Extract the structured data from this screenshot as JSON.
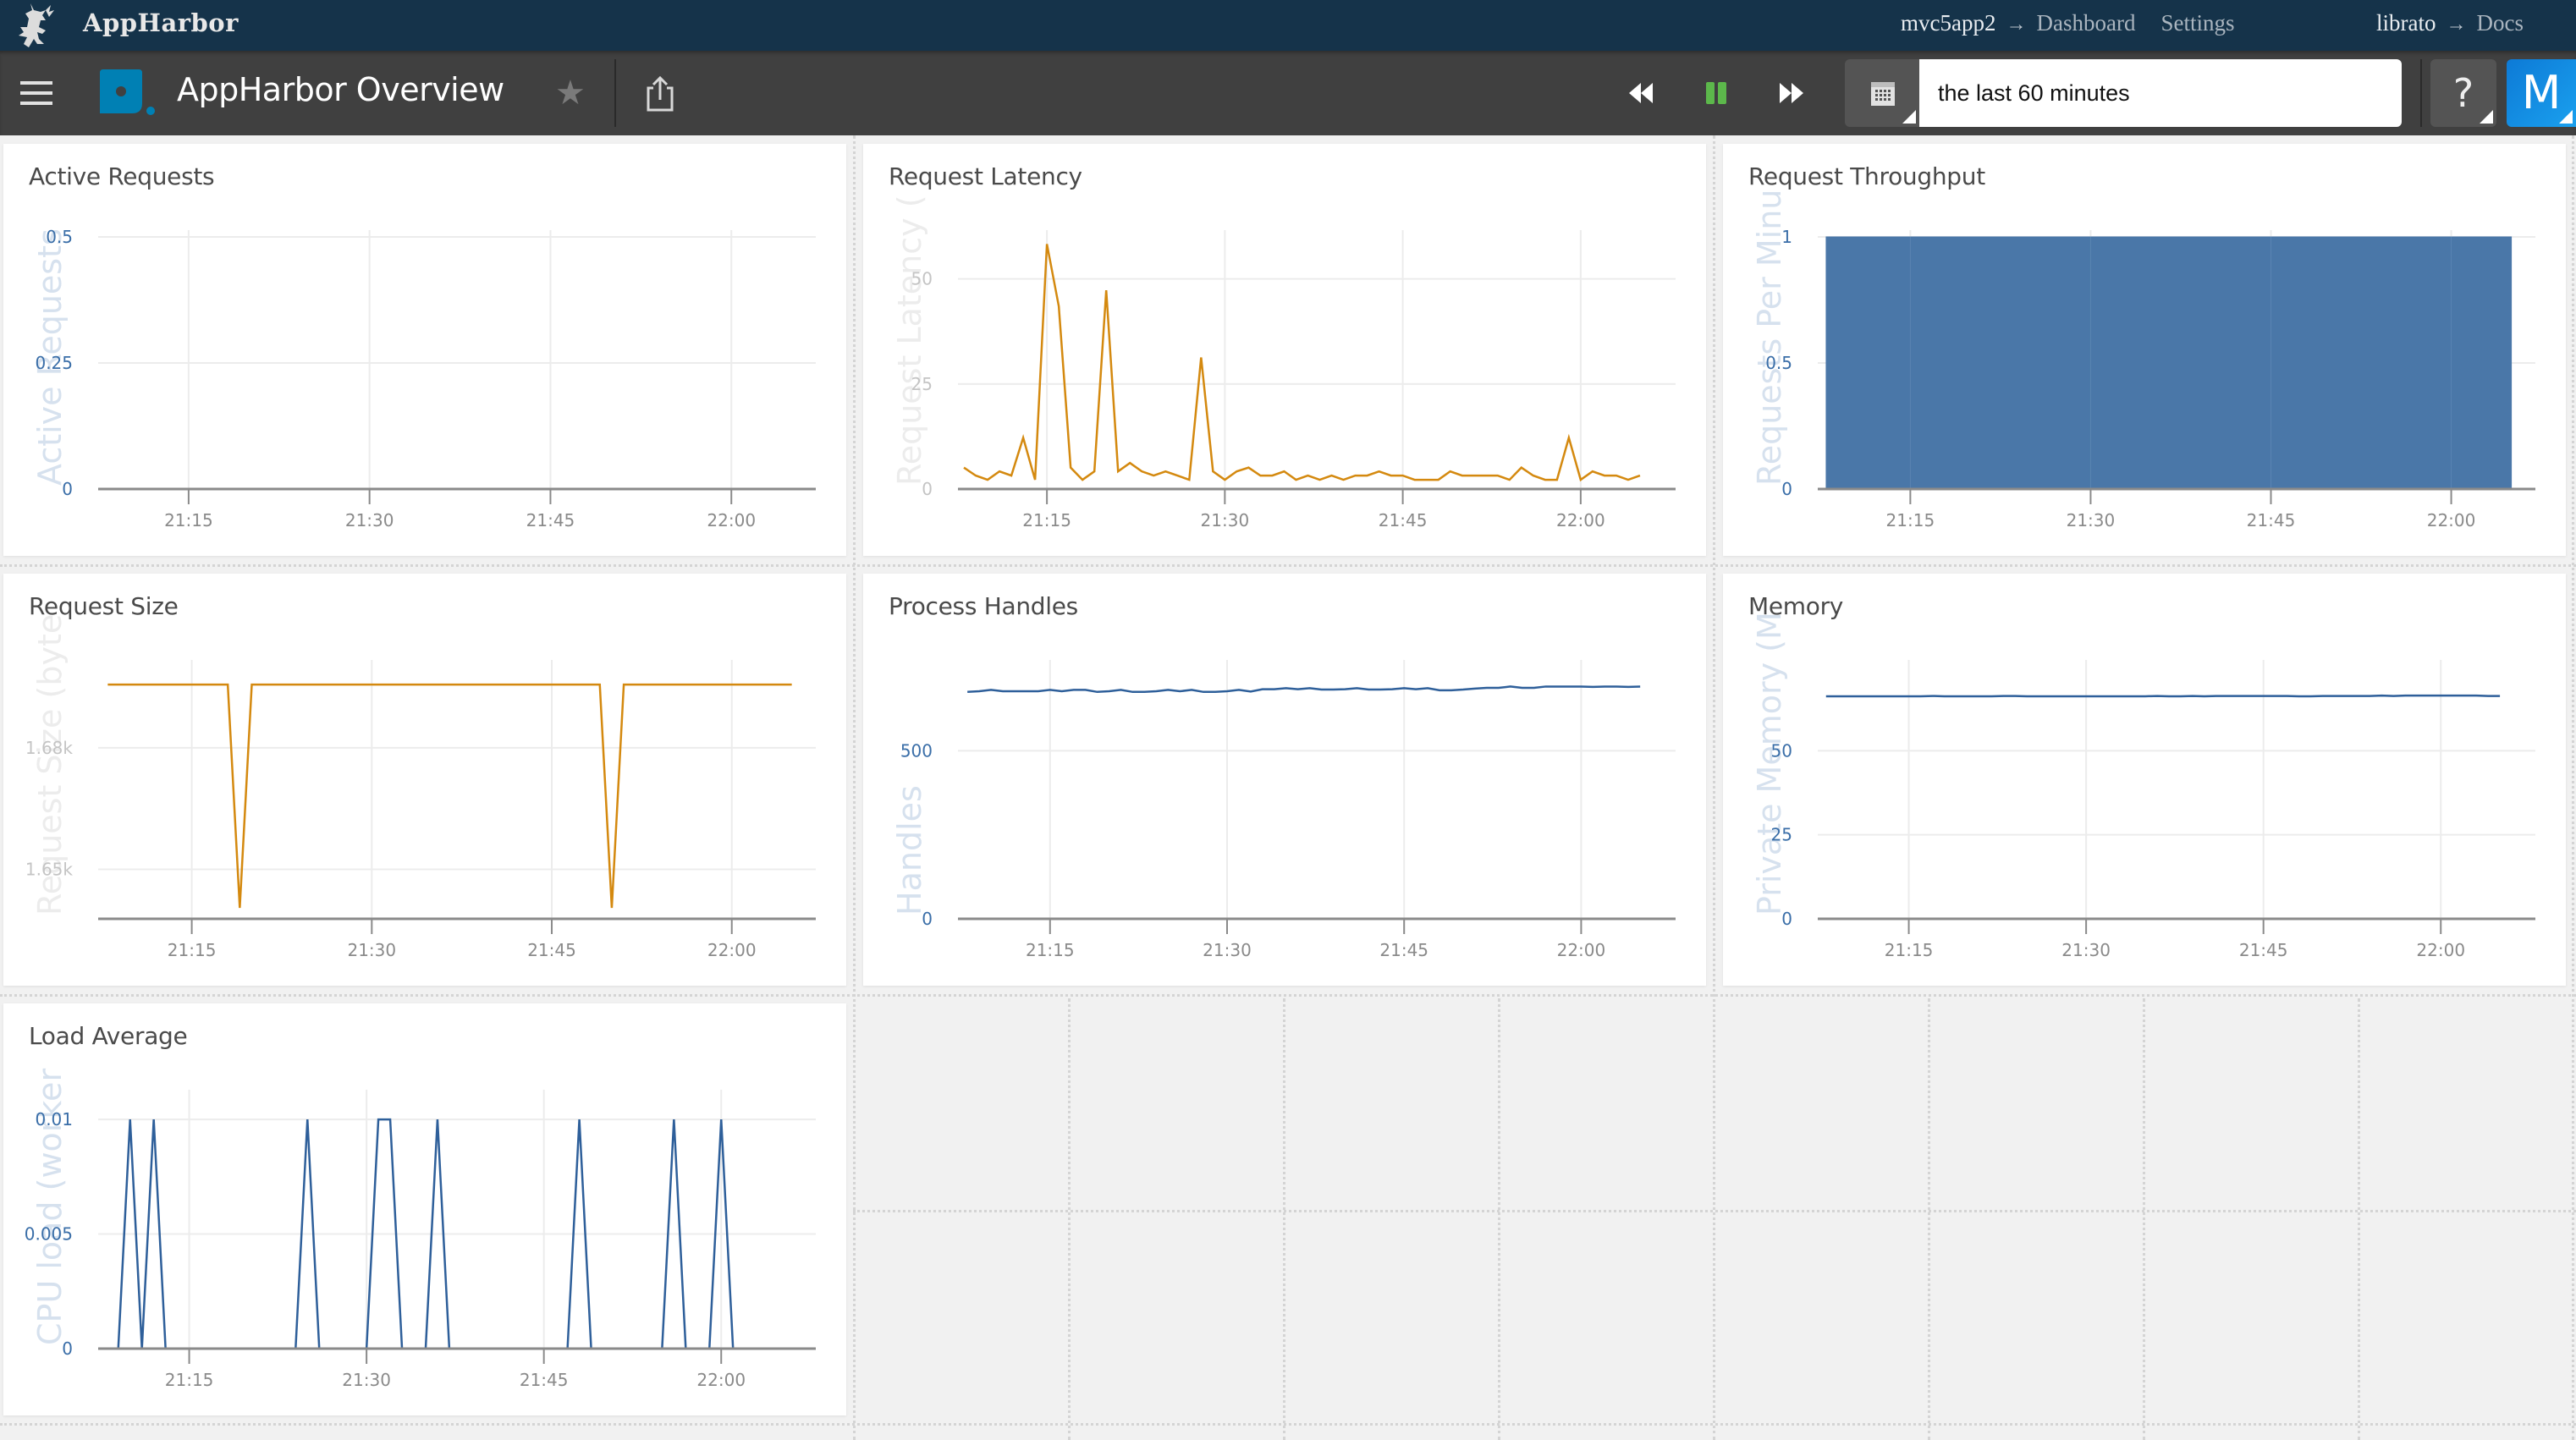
{
  "topbar": {
    "brand": "AppHarbor",
    "app_name": "mvc5app2",
    "arrow": "→",
    "dashboard_link": "Dashboard",
    "settings_link": "Settings",
    "addon_name": "librato",
    "docs_link": "Docs",
    "logo_icon": "appharbor-dragon-logo"
  },
  "toolbar": {
    "menu_icon": "hamburger-menu-icon",
    "dashboard_title": "AppHarbor Overview",
    "star_icon": "★",
    "share_icon": "share-icon",
    "rewind_icon": "rewind-icon",
    "pause_icon": "pause-icon",
    "forward_icon": "fast-forward-icon",
    "calendar_icon": "calendar-icon",
    "time_range": "the last 60 minutes",
    "help_label": "?",
    "user_initial": "M",
    "colors": {
      "topbar_bg": "#15334a",
      "toolbar_bg": "#404040",
      "pause_green": "#5cb84b",
      "user_blue": "#1a8fe3",
      "logo_blue": "#0080b4"
    }
  },
  "x_ticks": [
    "21:15",
    "21:30",
    "21:45",
    "22:00"
  ],
  "chart_data": [
    {
      "id": "active-requests",
      "type": "line",
      "title": "Active Requests",
      "ylabel": "Active Requests",
      "color": "#2e5f9a",
      "ylim": [
        0,
        0.5
      ],
      "yticks": [
        0,
        0.25,
        0.5
      ],
      "ytick_labels": [
        "0",
        "0.25",
        "0.5"
      ],
      "ytick_style": "blue",
      "x_start": "21:08",
      "x_end": "22:05",
      "x_range_minutes": [
        -7.5,
        52
      ],
      "xticks": [
        "21:15",
        "21:30",
        "21:45",
        "22:00"
      ],
      "values": [
        0,
        0,
        0,
        0,
        0,
        0,
        0,
        0,
        0,
        0,
        0,
        0,
        0,
        0,
        0,
        0,
        0,
        0,
        0,
        0,
        0,
        0,
        0,
        0,
        0,
        0,
        0,
        0,
        0,
        0,
        0,
        0,
        0,
        0,
        0,
        0,
        0,
        0,
        0,
        0,
        0,
        0,
        0,
        0,
        0,
        0,
        0,
        0,
        0,
        0,
        0,
        0,
        0,
        0,
        0,
        0,
        0,
        0
      ]
    },
    {
      "id": "request-latency",
      "type": "line",
      "title": "Request Latency",
      "ylabel": "Request Latency (",
      "color": "#d4890f",
      "ylim": [
        0,
        60
      ],
      "yticks": [
        0,
        25,
        50
      ],
      "ytick_labels": [
        "0",
        "25",
        "50"
      ],
      "ytick_style": "gray",
      "x_start": "21:08",
      "x_end": "22:05",
      "x_range_minutes": [
        -7.5,
        53
      ],
      "xticks": [
        "21:15",
        "21:30",
        "21:45",
        "22:00"
      ],
      "values": [
        5.1,
        3.2,
        2.2,
        4.2,
        3.2,
        12.2,
        2.2,
        58.3,
        43.5,
        5.1,
        2.2,
        4.2,
        47.3,
        4.2,
        6.2,
        4.2,
        3.2,
        4.2,
        3.2,
        2.2,
        31.3,
        4.2,
        2.2,
        4.2,
        5.1,
        3.2,
        3.2,
        4.2,
        2.2,
        3.2,
        2.2,
        3.2,
        2.2,
        3.2,
        3.2,
        4.2,
        3.2,
        3.2,
        2.2,
        2.2,
        2.2,
        4.2,
        3.2,
        3.2,
        3.2,
        3.2,
        2.2,
        5.1,
        3.2,
        2.2,
        2.2,
        12.2,
        2.2,
        4.2,
        3.2,
        3.2,
        2.2,
        3.2
      ]
    },
    {
      "id": "request-throughput",
      "type": "area",
      "title": "Request Throughput",
      "ylabel": "Requests Per Minu",
      "color": "#4a77a8",
      "ylim": [
        0,
        1
      ],
      "yticks": [
        0,
        0.5,
        1
      ],
      "ytick_labels": [
        "0",
        "0.5",
        "1"
      ],
      "ytick_style": "blue",
      "x_start": "21:08",
      "x_end": "22:05",
      "x_range_minutes": [
        -7.7,
        52
      ],
      "xticks": [
        "21:15",
        "21:30",
        "21:45",
        "22:00"
      ],
      "values": [
        1,
        1,
        1,
        1,
        1,
        1,
        1,
        1,
        1,
        1,
        1,
        1,
        1,
        1,
        1,
        1,
        1,
        1,
        1,
        1,
        1,
        1,
        1,
        1,
        1,
        1,
        1,
        1,
        1,
        1,
        1,
        1,
        1,
        1,
        1,
        1,
        1,
        1,
        1,
        1,
        1,
        1,
        1,
        1,
        1,
        1,
        1,
        1,
        1,
        1,
        1,
        1,
        1,
        1,
        1,
        1,
        1,
        1
      ]
    },
    {
      "id": "request-size",
      "type": "line",
      "title": "Request Size",
      "ylabel": "Request Size (byte",
      "color": "#d4890f",
      "ylim": [
        1637.8,
        1700
      ],
      "yticks": [
        1650,
        1680
      ],
      "ytick_labels": [
        "1.65k",
        "1.68k"
      ],
      "ytick_style": "gray",
      "x_start": "21:08",
      "x_end": "22:05",
      "x_range_minutes": [
        -7.8,
        52
      ],
      "xticks": [
        "21:15",
        "21:30",
        "21:45",
        "22:00"
      ],
      "values": [
        1695.6,
        1695.6,
        1695.6,
        1695.6,
        1695.6,
        1695.6,
        1695.6,
        1695.6,
        1695.6,
        1695.6,
        1695.6,
        1640.5,
        1695.6,
        1695.6,
        1695.6,
        1695.6,
        1695.6,
        1695.6,
        1695.6,
        1695.6,
        1695.6,
        1695.6,
        1695.6,
        1695.6,
        1695.6,
        1695.6,
        1695.6,
        1695.6,
        1695.6,
        1695.6,
        1695.6,
        1695.6,
        1695.6,
        1695.6,
        1695.6,
        1695.6,
        1695.6,
        1695.6,
        1695.6,
        1695.6,
        1695.6,
        1695.6,
        1640.5,
        1695.6,
        1695.6,
        1695.6,
        1695.6,
        1695.6,
        1695.6,
        1695.6,
        1695.6,
        1695.6,
        1695.6,
        1695.6,
        1695.6,
        1695.6,
        1695.6,
        1695.6
      ]
    },
    {
      "id": "process-handles",
      "type": "line",
      "title": "Process Handles",
      "ylabel": "Handles",
      "color": "#2e5f9a",
      "ylim": [
        0,
        750
      ],
      "yticks": [
        0,
        500
      ],
      "ytick_labels": [
        "0",
        "500"
      ],
      "ytick_style": "blue",
      "x_start": "21:08",
      "x_end": "22:05",
      "x_range_minutes": [
        -7.8,
        53
      ],
      "xticks": [
        "21:15",
        "21:30",
        "21:45",
        "22:00"
      ],
      "values": [
        675,
        677,
        681,
        677,
        677,
        677,
        677,
        681,
        677,
        681,
        681,
        675,
        677,
        681,
        675,
        675,
        677,
        681,
        677,
        681,
        675,
        675,
        677,
        681,
        676,
        683,
        683,
        686,
        683,
        686,
        682,
        682,
        683,
        686,
        682,
        682,
        683,
        686,
        683,
        686,
        680,
        680,
        682,
        685,
        687,
        687,
        691,
        687,
        687,
        691,
        691,
        691,
        691,
        690,
        691,
        691,
        690,
        691
      ]
    },
    {
      "id": "memory",
      "type": "line",
      "title": "Memory",
      "ylabel": "Private Memory (M",
      "color": "#2e5f9a",
      "ylim": [
        0,
        75
      ],
      "yticks": [
        0,
        25,
        50
      ],
      "ytick_labels": [
        "0",
        "25",
        "50"
      ],
      "ytick_style": "blue",
      "x_start": "21:08",
      "x_end": "22:05",
      "x_range_minutes": [
        -7.7,
        53
      ],
      "xticks": [
        "21:15",
        "21:30",
        "21:45",
        "22:00"
      ],
      "values": [
        66.2,
        66.2,
        66.2,
        66.2,
        66.2,
        66.2,
        66.2,
        66.2,
        66.2,
        66.3,
        66.2,
        66.2,
        66.2,
        66.2,
        66.2,
        66.3,
        66.3,
        66.2,
        66.2,
        66.2,
        66.2,
        66.2,
        66.2,
        66.2,
        66.2,
        66.2,
        66.2,
        66.2,
        66.3,
        66.2,
        66.2,
        66.3,
        66.2,
        66.3,
        66.3,
        66.3,
        66.3,
        66.3,
        66.3,
        66.3,
        66.2,
        66.2,
        66.3,
        66.3,
        66.3,
        66.3,
        66.3,
        66.4,
        66.3,
        66.4,
        66.4,
        66.4,
        66.4,
        66.4,
        66.4,
        66.4,
        66.3,
        66.3
      ]
    },
    {
      "id": "load-average",
      "type": "line",
      "title": "Load Average",
      "ylabel": "CPU load (worker",
      "color": "#2e5f9a",
      "ylim": [
        0,
        0.011
      ],
      "yticks": [
        0,
        0.005,
        0.01
      ],
      "ytick_labels": [
        "0",
        "0.005",
        "0.01"
      ],
      "ytick_style": "blue",
      "x_start": "21:08",
      "x_end": "22:05",
      "x_range_minutes": [
        -7.7,
        53
      ],
      "xticks": [
        "21:15",
        "21:30",
        "21:45",
        "22:00"
      ],
      "values": [
        0,
        0,
        0.01,
        0,
        0.01,
        0,
        0,
        0,
        0,
        0,
        0,
        0,
        0,
        0,
        0,
        0,
        0,
        0.01,
        0,
        0,
        0,
        0,
        0,
        0.01,
        0.01,
        0,
        0,
        0,
        0.01,
        0,
        0,
        0,
        0,
        0,
        0,
        0,
        0,
        0,
        0,
        0,
        0.01,
        0,
        0,
        0,
        0,
        0,
        0,
        0,
        0.01,
        0,
        0,
        0,
        0.01,
        0,
        0,
        0,
        0,
        0
      ]
    }
  ]
}
